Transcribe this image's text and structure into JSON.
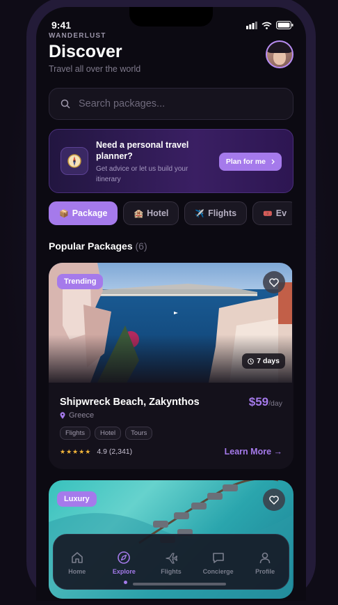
{
  "status_bar": {
    "time": "9:41"
  },
  "header": {
    "brand": "WANDERLUST",
    "title": "Discover",
    "subtitle": "Travel all over the world"
  },
  "search": {
    "placeholder": "Search packages..."
  },
  "planner": {
    "title": "Need a personal travel planner?",
    "description": "Get advice or let us build your itinerary",
    "button": "Plan for me"
  },
  "categories": [
    {
      "label": "Package",
      "active": true
    },
    {
      "label": "Hotel",
      "active": false
    },
    {
      "label": "Flights",
      "active": false
    },
    {
      "label": "Ev",
      "active": false
    }
  ],
  "section": {
    "title": "Popular Packages",
    "count": "(6)"
  },
  "packages": [
    {
      "tag": "Trending",
      "duration": "7 days",
      "name": "Shipwreck Beach, Zakynthos",
      "price": "$59",
      "price_unit": "/day",
      "location": "Greece",
      "features": [
        "Flights",
        "Hotel",
        "Tours"
      ],
      "stars": 5,
      "rating": "4.9 (2,341)",
      "cta": "Learn More →"
    },
    {
      "tag": "Luxury"
    }
  ],
  "tabbar": [
    {
      "label": "Home",
      "icon": "home-icon",
      "active": false
    },
    {
      "label": "Explore",
      "icon": "compass-icon",
      "active": true
    },
    {
      "label": "Flights",
      "icon": "plane-icon",
      "active": false
    },
    {
      "label": "Concierge",
      "icon": "chat-icon",
      "active": false
    },
    {
      "label": "Profile",
      "icon": "user-icon",
      "active": false
    }
  ],
  "colors": {
    "accent": "#a57aeb",
    "background": "#0c0a12",
    "star": "#f2b53a"
  }
}
